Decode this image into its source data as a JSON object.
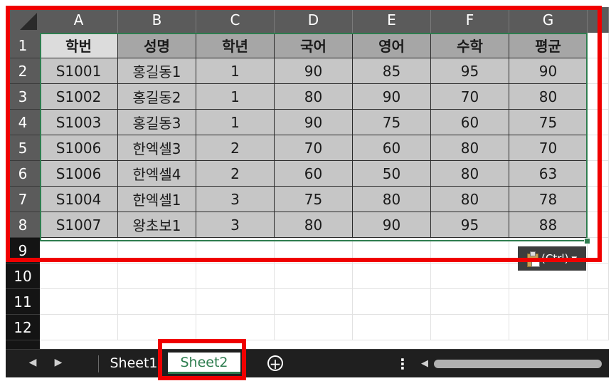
{
  "columns": [
    "A",
    "B",
    "C",
    "D",
    "E",
    "F",
    "G"
  ],
  "rows": [
    "1",
    "2",
    "3",
    "4",
    "5",
    "6",
    "7",
    "8",
    "9",
    "10",
    "11",
    "12"
  ],
  "table": {
    "header": [
      "학번",
      "성명",
      "학년",
      "국어",
      "영어",
      "수학",
      "평균"
    ],
    "records": [
      [
        "S1001",
        "홍길동1",
        "1",
        "90",
        "85",
        "95",
        "90"
      ],
      [
        "S1002",
        "홍길동2",
        "1",
        "80",
        "90",
        "70",
        "80"
      ],
      [
        "S1003",
        "홍길동3",
        "1",
        "90",
        "75",
        "60",
        "75"
      ],
      [
        "S1006",
        "한엑셀3",
        "2",
        "70",
        "60",
        "80",
        "70"
      ],
      [
        "S1006",
        "한엑셀4",
        "2",
        "60",
        "50",
        "80",
        "63"
      ],
      [
        "S1004",
        "한엑셀1",
        "3",
        "75",
        "80",
        "80",
        "78"
      ],
      [
        "S1007",
        "왕초보1",
        "3",
        "80",
        "90",
        "95",
        "88"
      ]
    ]
  },
  "paste_options": {
    "label": "(Ctrl)",
    "icon": "clipboard-icon",
    "chevron": "▾"
  },
  "tabs": [
    {
      "label": "Sheet1",
      "active": false
    },
    {
      "label": "Sheet2",
      "active": true
    }
  ],
  "icons": {
    "prev": "◀",
    "next": "▶",
    "add": "+",
    "more": "⋮",
    "scroll_left": "◀"
  },
  "colors": {
    "annotation": "#f00000",
    "active_tab": "#2e7d4f",
    "selection": "#2e7d4f"
  }
}
